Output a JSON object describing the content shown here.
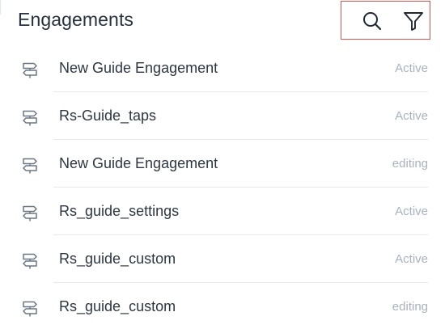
{
  "header": {
    "title": "Engagements"
  },
  "toolbar": {
    "search_icon": "search-icon",
    "filter_icon": "filter-icon"
  },
  "engagements": [
    {
      "name": "New Guide Engagement",
      "status": "Active",
      "icon": "signpost-icon"
    },
    {
      "name": "Rs-Guide_taps",
      "status": "Active",
      "icon": "signpost-icon"
    },
    {
      "name": "New Guide Engagement",
      "status": "editing",
      "icon": "signpost-icon"
    },
    {
      "name": "Rs_guide_settings",
      "status": "Active",
      "icon": "signpost-icon"
    },
    {
      "name": "Rs_guide_custom",
      "status": "Active",
      "icon": "signpost-icon"
    },
    {
      "name": "Rs_guide_custom",
      "status": "editing",
      "icon": "signpost-icon"
    }
  ],
  "colors": {
    "highlight_border": "#d9534f",
    "status_text": "#a9b2be",
    "title_text": "#27313d"
  }
}
